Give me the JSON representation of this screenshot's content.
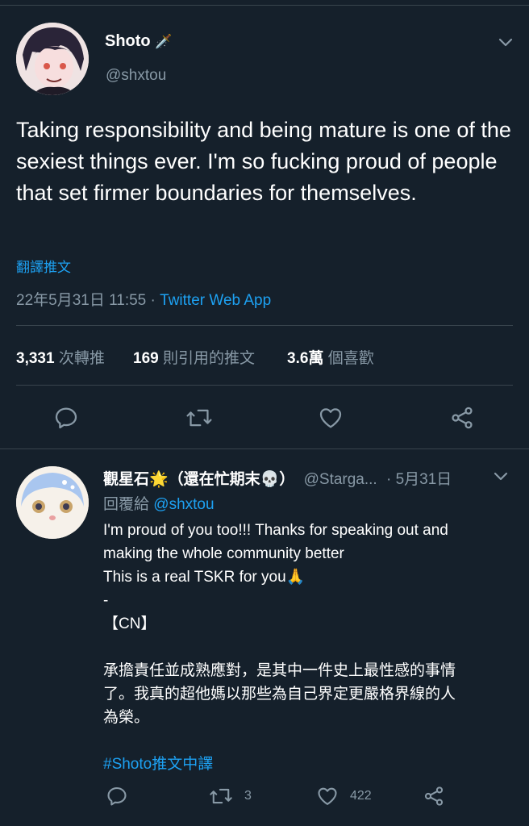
{
  "tweet": {
    "author_name": "Shoto",
    "author_name_emoji": "🗡️",
    "handle": "@shxtou",
    "text": "Taking responsibility and being mature is one of the sexiest things ever. I'm so fucking proud of people that set firmer boundaries for themselves.",
    "translate_label": "翻譯推文",
    "timestamp": "22年5月31日 11:55",
    "separator": " · ",
    "source": "Twitter Web App",
    "stats": {
      "retweets_value": "3,331",
      "retweets_label": "次轉推",
      "quotes_value": "169",
      "quotes_label": "則引用的推文",
      "likes_value": "3.6萬",
      "likes_label": "個喜歡"
    }
  },
  "reply": {
    "author_name": "觀星石🌟（還在忙期末💀）",
    "handle": "@Starga...",
    "date": "· 5月31日",
    "replying_to_label": "回覆給",
    "replying_to_handle": "@shxtou",
    "lines": [
      "I'm proud of you too!!! Thanks for speaking out and",
      "making the whole community better",
      "This is a real TSKR for you🙏",
      "-",
      "【CN】",
      "",
      "承擔責任並成熟應對，是其中一件史上最性感的事情",
      "了。我真的超他媽以那些為自己界定更嚴格界線的人",
      "為榮。",
      ""
    ],
    "hashtag": "#Shoto推文中譯",
    "retweet_count": "3",
    "like_count": "422"
  },
  "icons": {
    "chevron": "chevron-down-icon",
    "reply": "reply-icon",
    "retweet": "retweet-icon",
    "like": "heart-icon",
    "share": "share-icon"
  },
  "colors": {
    "background": "#15202b",
    "accent": "#1da1f2",
    "muted": "#8899a6",
    "divider": "#38444d"
  }
}
